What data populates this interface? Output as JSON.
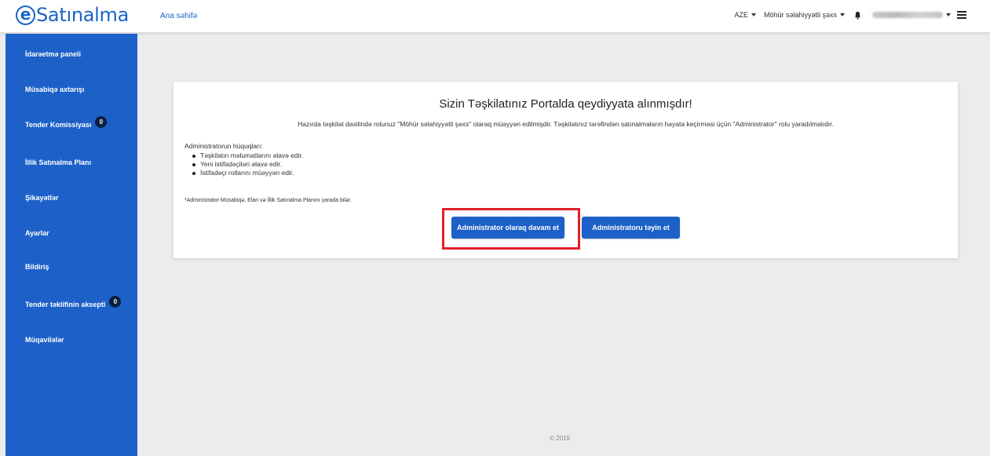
{
  "header": {
    "logo_letter": "e",
    "logo_text": "Satınalma",
    "home_link": "Ana səhifə",
    "language": "AZE",
    "role": "Möhür səlahiyyətli şəxs",
    "icons": [
      "bell-icon",
      "hamburger-icon"
    ]
  },
  "sidebar": {
    "items": [
      {
        "label": "İdarəetmə paneli",
        "badge": null
      },
      {
        "label": "Müsabiqə axtarışı",
        "badge": null
      },
      {
        "label": "Tender Komissiyası",
        "badge": "0"
      },
      {
        "label": "İllik Satınalma Planı",
        "badge": null
      },
      {
        "label": "Şikayətlər",
        "badge": null
      },
      {
        "label": "Ayarlar",
        "badge": null
      },
      {
        "label": "Bildiriş",
        "badge": null
      },
      {
        "label": "Tender təklifinin aksepti",
        "badge": "0"
      },
      {
        "label": "Müqavilələr",
        "badge": null
      }
    ]
  },
  "main": {
    "title": "Sizin Təşkilatınız Portalda qeydiyyata alınmışdır!",
    "description": "Hazırda təşkilat daxilində rolunuz \"Möhür səlahiyyətli şəxs\" olaraq müəyyən edilmişdir. Təşkilatınız tərəfindən satınalmaların həyata keçirməsi üçün \"Administrator\" rolu yaradılmalıdır.",
    "rights_title": "Administratorun hüquqları:",
    "rights": [
      "Təşkilatın məlumatlarını əlavə edir.",
      "Yeni istifadəçiləri əlavə edir.",
      "İstifadəçi rollarını müəyyən edir."
    ],
    "note": "*Administrator Müsabiqə, Elan və İllik Satınalma Planını yarada bilər.",
    "btn_continue": "Administrator olaraq davam et",
    "btn_assign": "Administratoru təyin et"
  },
  "footer": {
    "copyright": "© 2019"
  },
  "colors": {
    "brand": "#1d61c8",
    "highlight": "#e0202a"
  }
}
